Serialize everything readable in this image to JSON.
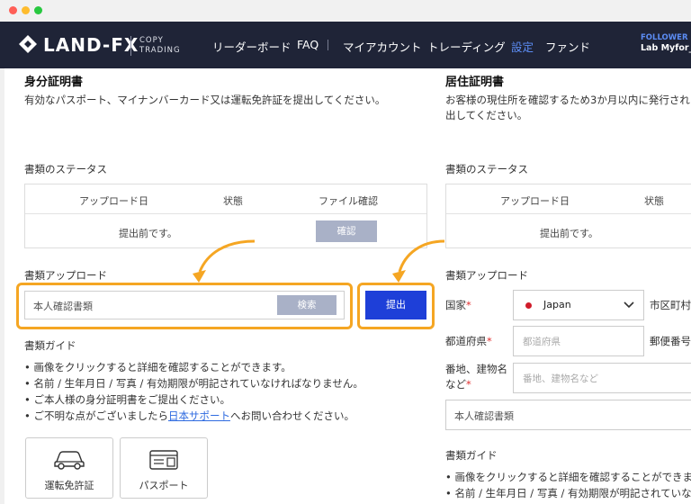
{
  "window": {
    "dots": [
      "#ff5f57",
      "#febc2e",
      "#28c840"
    ]
  },
  "nav": {
    "logo_text": "LAND-FX",
    "logo_sub_1": "COPY",
    "logo_sub_2": "TRADING",
    "items": [
      {
        "label": "リーダーボード"
      },
      {
        "label": "FAQ"
      },
      {
        "label": "マイアカウント"
      },
      {
        "label": "トレーディング"
      },
      {
        "label": "設定",
        "active": true
      },
      {
        "label": "ファンド"
      }
    ],
    "follower_label": "FOLLOWER",
    "username": "Lab Myfor_"
  },
  "identity": {
    "title": "身分証明書",
    "description": "有効なパスポート、マイナンバーカード又は運転免許証を提出してください。",
    "status_label": "書類のステータス",
    "table_headers": [
      "アップロード日",
      "状態",
      "ファイル確認"
    ],
    "table_row": {
      "text": "提出前です。",
      "confirm_label": "確認"
    },
    "upload_label": "書類アップロード",
    "upload_value": "本人確認書類",
    "search_label": "検索",
    "submit_label": "提出",
    "guide_title": "書類ガイド",
    "guide_items": [
      "画像をクリックすると詳細を確認することができます。",
      "名前 / 生年月日 / 写真 / 有効期限が明記されていなければなりません。",
      "ご本人様の身分証明書をご提出ください。"
    ],
    "guide_last_before": "ご不明な点がございましたら",
    "guide_link": "日本サポート",
    "guide_last_after": "へお問い合わせください。",
    "doc_cards": [
      "運転免許証",
      "パスポート"
    ]
  },
  "residence": {
    "title": "居住証明書",
    "description_1": "お客様の現住所を確認するため3か月以内に発行された",
    "description_2": "出してください。",
    "status_label": "書類のステータス",
    "table_headers": [
      "アップロード日",
      "状態"
    ],
    "table_row": {
      "text": "提出前です。"
    },
    "upload_label": "書類アップロード",
    "country_label": "国家",
    "country_value": "Japan",
    "city_label": "市区町村",
    "prefecture_label": "都道府県",
    "prefecture_placeholder": "都道府県",
    "postal_label": "郵便番号",
    "address_label_1": "番地、建物名",
    "address_label_2": "など",
    "address_placeholder": "番地、建物名など",
    "doc_value": "本人確認書類",
    "guide_title": "書類ガイド",
    "guide_items": [
      "画像をクリックすると詳細を確認することができま",
      "名前 / 生年月日 / 写真 / 有効期限が明記されていな"
    ]
  },
  "colors": {
    "accent": "#1e3fd8",
    "highlight": "#f5a623",
    "navbar": "#1f2437",
    "active_nav": "#5c8df5"
  }
}
